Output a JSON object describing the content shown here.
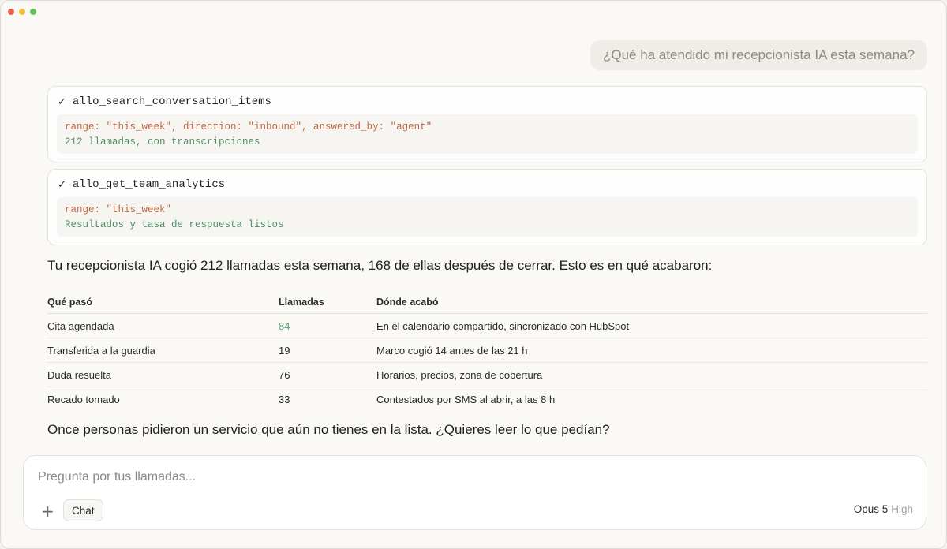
{
  "user_message": "¿Qué ha atendido mi recepcionista IA esta semana?",
  "tool_calls": [
    {
      "status_icon": "✓",
      "name": "allo_search_conversation_items",
      "args": "range: \"this_week\", direction: \"inbound\", answered_by: \"agent\"",
      "result": "212 llamadas, con transcripciones"
    },
    {
      "status_icon": "✓",
      "name": "allo_get_team_analytics",
      "args": "range: \"this_week\"",
      "result": "Resultados y tasa de respuesta listos"
    }
  ],
  "summary": "Tu recepcionista IA cogió 212 llamadas esta semana, 168 de ellas después de cerrar. Esto es en qué acabaron:",
  "table": {
    "headers": [
      "Qué pasó",
      "Llamadas",
      "Dónde acabó"
    ],
    "rows": [
      [
        "Cita agendada",
        "84",
        "En el calendario compartido, sincronizado con HubSpot"
      ],
      [
        "Transferida a la guardia",
        "19",
        "Marco cogió 14 antes de las 21 h"
      ],
      [
        "Duda resuelta",
        "76",
        "Horarios, precios, zona de cobertura"
      ],
      [
        "Recado tomado",
        "33",
        "Contestados por SMS al abrir, a las 8 h"
      ]
    ]
  },
  "followup": "Once personas pidieron un servicio que aún no tienes en la lista. ¿Quieres leer lo que pedían?",
  "composer": {
    "placeholder": "Pregunta por tus llamadas...",
    "add_icon": "+",
    "mode_label": "Chat",
    "model_name": "Opus 5",
    "model_effort": "High"
  },
  "colors": {
    "args": "#c26a45",
    "result": "#4f8f68",
    "accent_number": "#5b9c76"
  }
}
